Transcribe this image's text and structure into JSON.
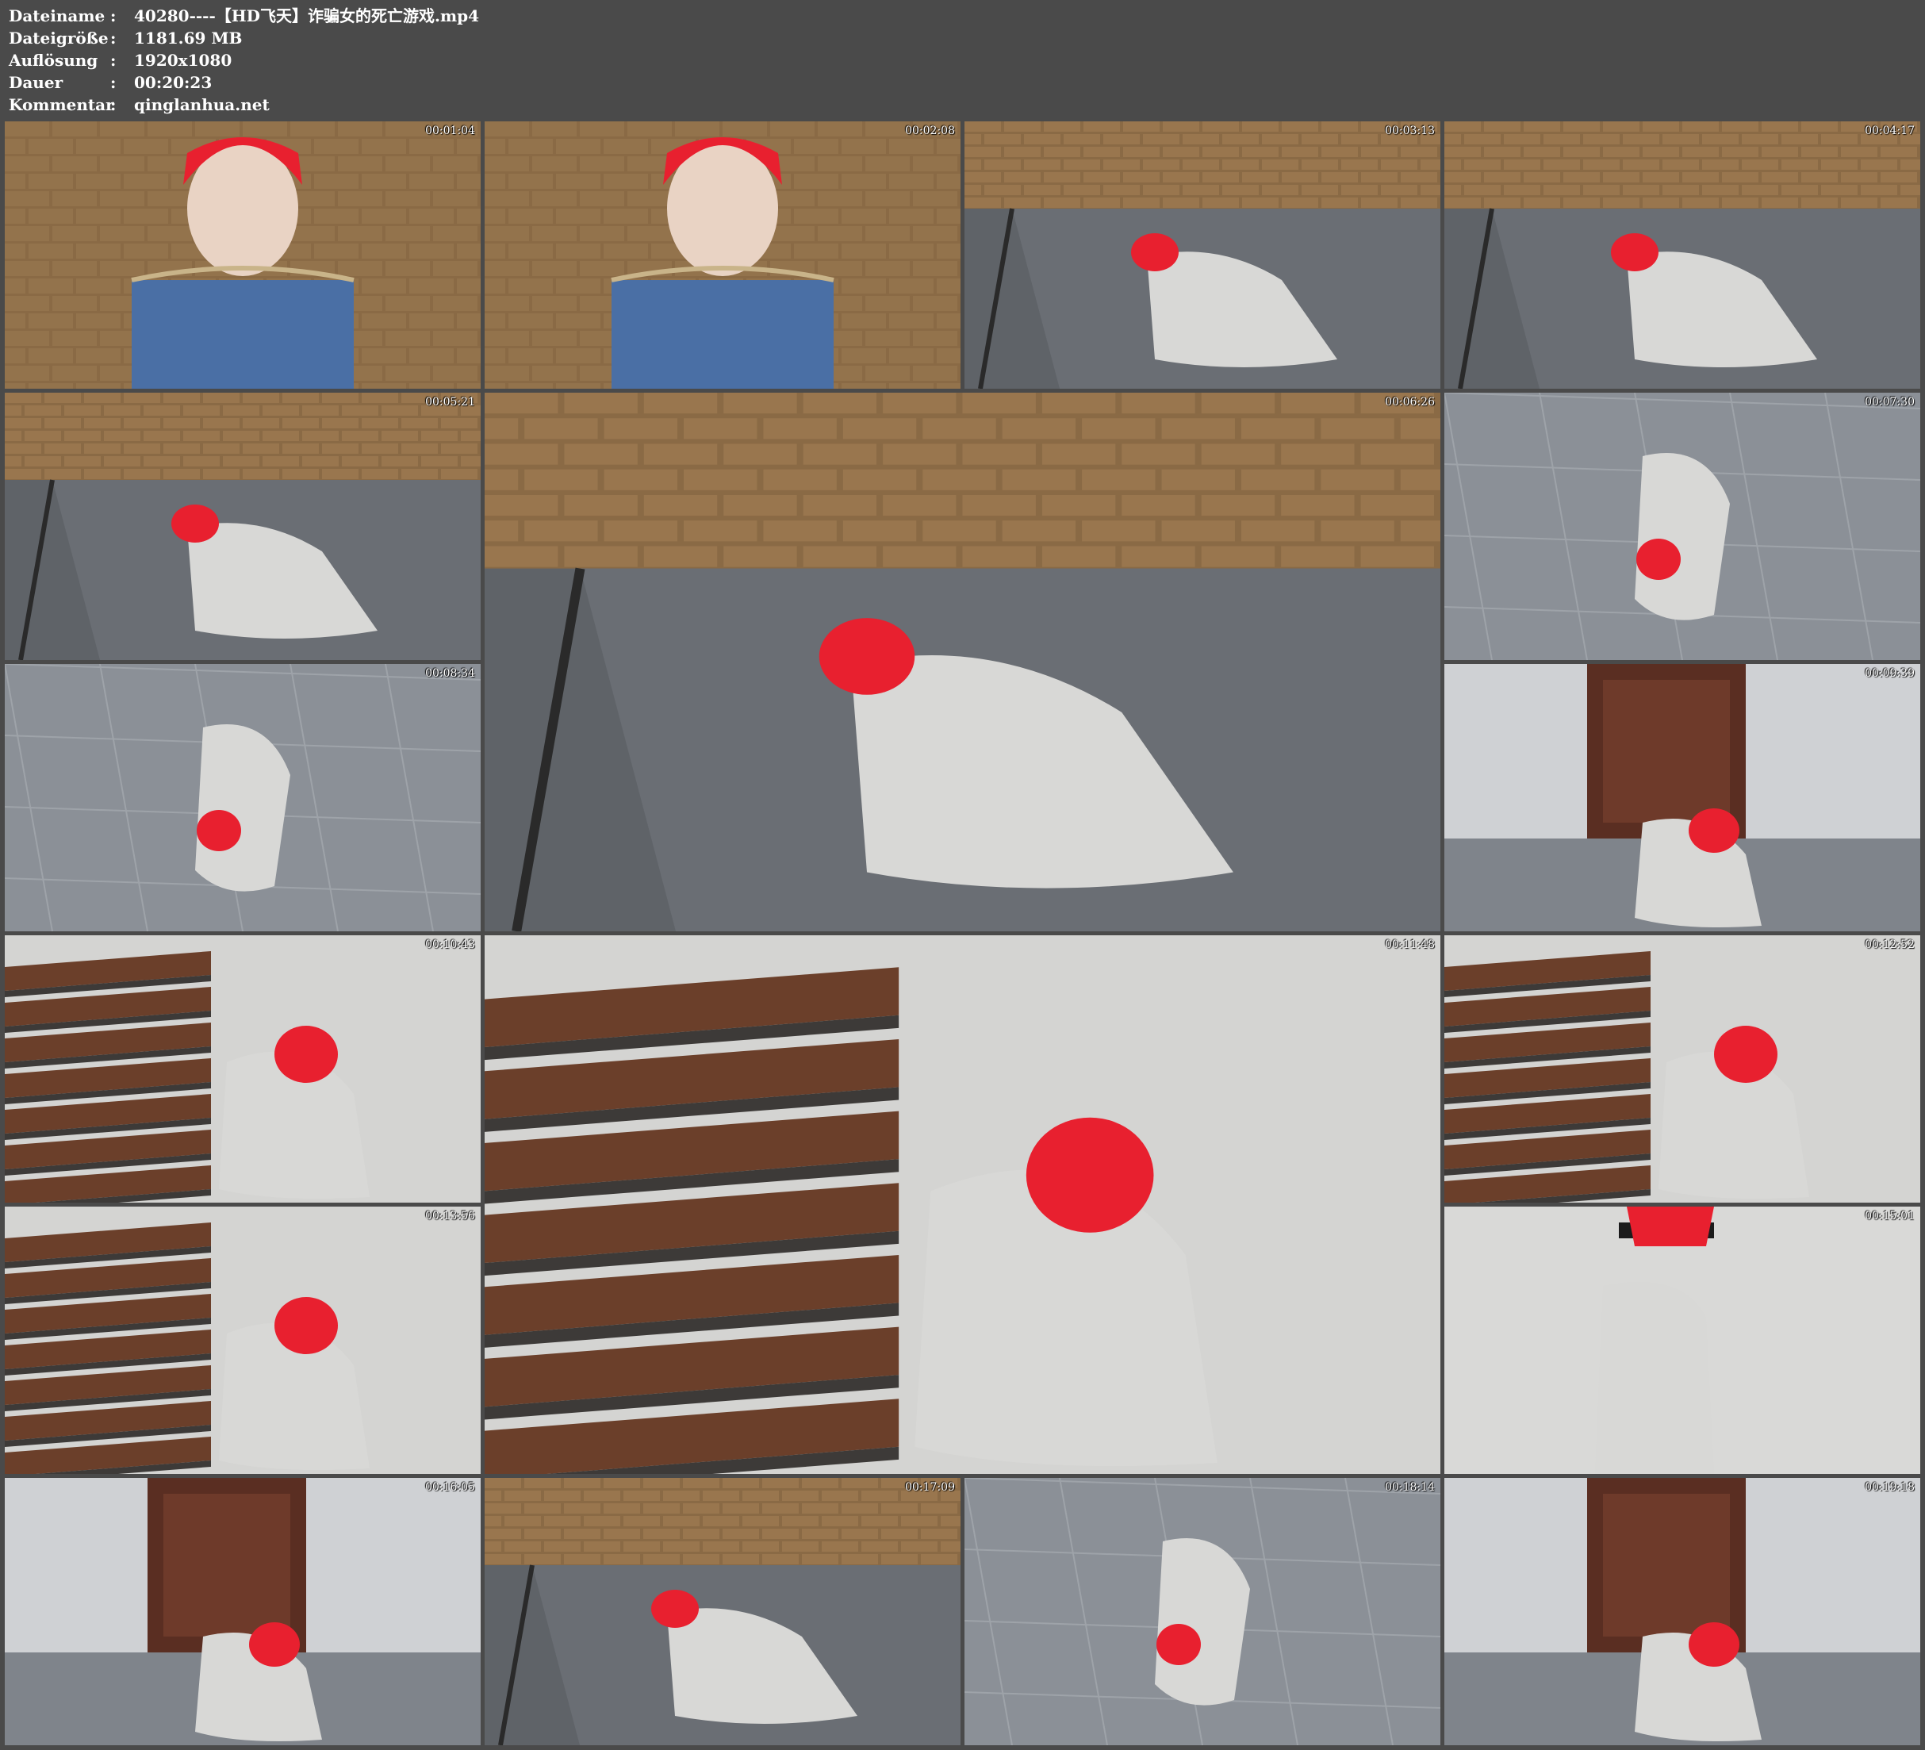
{
  "info": {
    "rows": [
      {
        "key": "Dateiname",
        "sep": ":",
        "value": "40280----【HD飞天】诈骗女的死亡游戏.mp4"
      },
      {
        "key": "Dateigröße",
        "sep": ":",
        "value": "1181.69 MB"
      },
      {
        "key": "Auflösung",
        "sep": ":",
        "value": "1920x1080"
      },
      {
        "key": "Dauer",
        "sep": ":",
        "value": "00:20:23"
      },
      {
        "key": "Kommentar",
        "sep": ":",
        "value": "qinglanhua.net"
      }
    ]
  },
  "frames": [
    {
      "timestamp": "00:01:04",
      "scene": "wall-portrait"
    },
    {
      "timestamp": "00:02:08",
      "scene": "wall-portrait"
    },
    {
      "timestamp": "00:03:13",
      "scene": "wall-floor"
    },
    {
      "timestamp": "00:04:17",
      "scene": "wall-floor"
    },
    {
      "timestamp": "00:05:21",
      "scene": "wall-floor"
    },
    {
      "timestamp": "00:06:26",
      "scene": "wall-floor"
    },
    {
      "timestamp": "00:07:30",
      "scene": "tiled-floor"
    },
    {
      "timestamp": "00:08:34",
      "scene": "tiled-floor"
    },
    {
      "timestamp": "00:09:39",
      "scene": "doorway"
    },
    {
      "timestamp": "00:10:43",
      "scene": "stairs"
    },
    {
      "timestamp": "00:11:48",
      "scene": "stairs"
    },
    {
      "timestamp": "00:12:52",
      "scene": "stairs"
    },
    {
      "timestamp": "00:13:56",
      "scene": "stairs"
    },
    {
      "timestamp": "00:15:01",
      "scene": "white-wall"
    },
    {
      "timestamp": "00:16:05",
      "scene": "doorway"
    },
    {
      "timestamp": "00:17:09",
      "scene": "wall-floor"
    },
    {
      "timestamp": "00:18:14",
      "scene": "tiled-floor"
    },
    {
      "timestamp": "00:19:18",
      "scene": "doorway"
    }
  ],
  "colors": {
    "background": "#4a4a4a",
    "text": "#ffffff",
    "brick": "#8a6a45",
    "floor": "#6f7378",
    "hair": "#e8202f"
  }
}
